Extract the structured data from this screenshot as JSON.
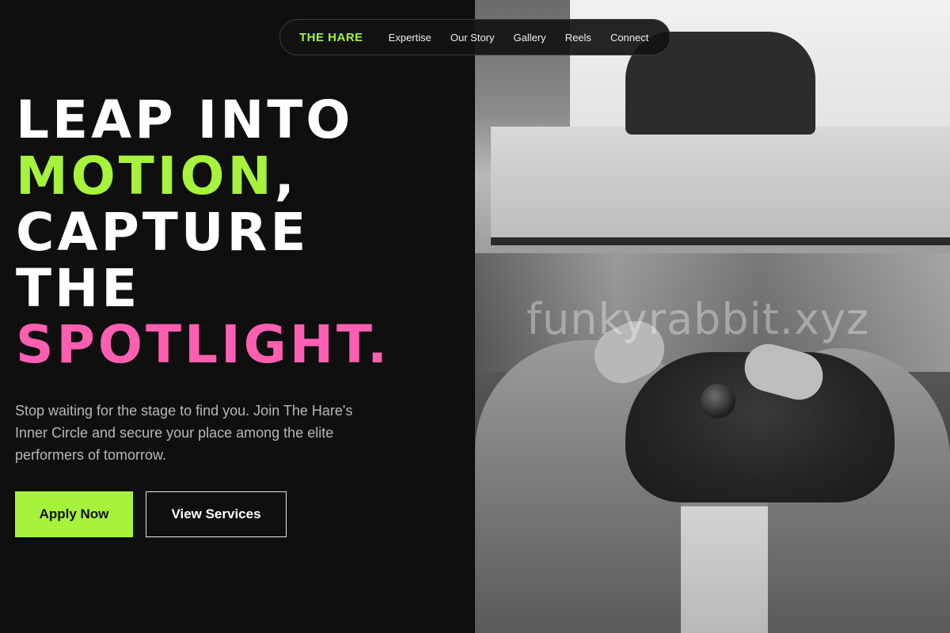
{
  "nav": {
    "brand": "THE HARE",
    "links": [
      "Expertise",
      "Our Story",
      "Gallery",
      "Reels",
      "Connect"
    ]
  },
  "hero": {
    "line1": "LEAP INTO",
    "line2_highlight": "MOTION",
    "line2_rest": ",",
    "line3": "CAPTURE",
    "line4": "THE",
    "line5_highlight": "SPOTLIGHT.",
    "description": "Stop waiting for the stage to find you. Join The Hare's Inner Circle and secure your place among the elite performers of tomorrow.",
    "primary_button": "Apply Now",
    "secondary_button": "View Services"
  },
  "watermark": "funkyrabbit.xyz",
  "colors": {
    "accent_green": "#a6f23c",
    "accent_pink": "#ff5fb0",
    "background": "#0f0f10"
  }
}
